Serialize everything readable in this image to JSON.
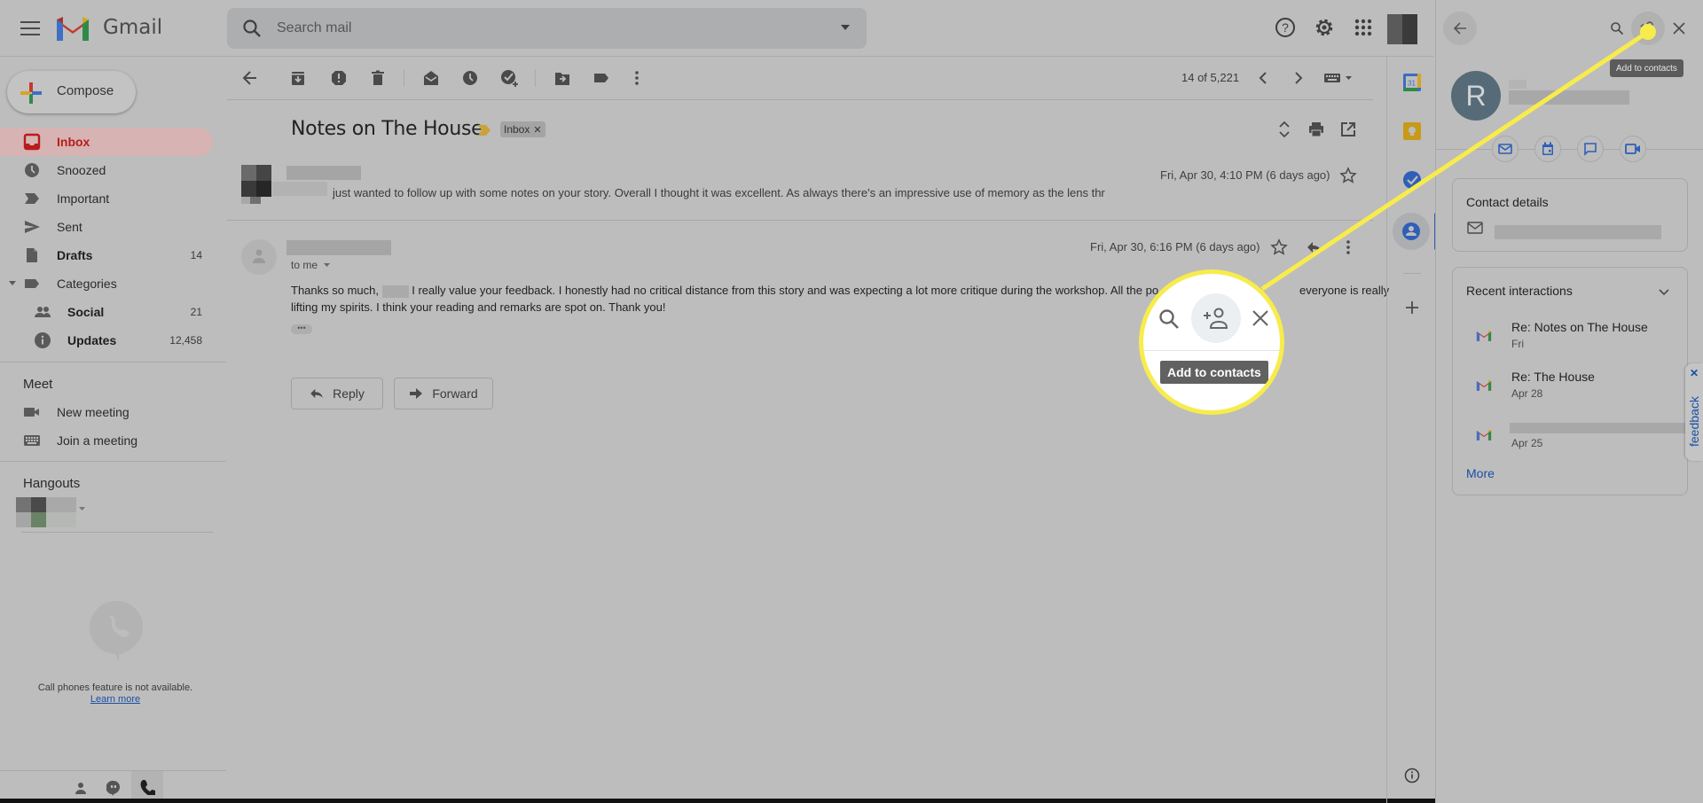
{
  "app": {
    "brand": "Gmail",
    "icons": {
      "menu": "hamburger-icon",
      "logo": "gmail-logo",
      "search": "search-icon",
      "help": "help-icon",
      "settings": "gear-icon",
      "apps": "apps-grid-icon"
    }
  },
  "search": {
    "placeholder": "Search mail",
    "value": ""
  },
  "nav": {
    "compose_label": "Compose",
    "items": [
      {
        "id": "inbox",
        "label": "Inbox",
        "count": "",
        "icon": "inbox-icon",
        "active": true
      },
      {
        "id": "snoozed",
        "label": "Snoozed",
        "count": "",
        "icon": "clock-icon"
      },
      {
        "id": "important",
        "label": "Important",
        "count": "",
        "icon": "important-icon"
      },
      {
        "id": "sent",
        "label": "Sent",
        "count": "",
        "icon": "send-icon"
      },
      {
        "id": "drafts",
        "label": "Drafts",
        "count": "14",
        "icon": "draft-icon",
        "bold": true
      },
      {
        "id": "categories",
        "label": "Categories",
        "count": "",
        "icon": "label-icon"
      },
      {
        "id": "social",
        "label": "Social",
        "count": "21",
        "icon": "people-icon",
        "bold": true
      },
      {
        "id": "updates",
        "label": "Updates",
        "count": "12,458",
        "icon": "info-icon",
        "bold": true
      }
    ],
    "meet": {
      "title": "Meet",
      "items": [
        {
          "label": "New meeting",
          "icon": "videocam-icon"
        },
        {
          "label": "Join a meeting",
          "icon": "keyboard-icon"
        }
      ]
    },
    "hangouts": {
      "title": "Hangouts",
      "call_unavailable": "Call phones feature is not available.",
      "learn_more": "Learn more"
    }
  },
  "toolbar": {
    "pager": "14 of 5,221",
    "icons": [
      "back-icon",
      "archive-icon",
      "report-spam-icon",
      "delete-icon",
      "mark-unread-icon",
      "snooze-icon",
      "add-task-icon",
      "move-to-icon",
      "label-icon",
      "more-icon"
    ]
  },
  "thread": {
    "subject": "Notes on The House",
    "label_chip": "Inbox",
    "messages": [
      {
        "collapsed": true,
        "snippet": "just wanted to follow up with some notes on your story. Overall I thought it was excellent. As always there's an impressive use of memory as the lens thr",
        "date": "Fri, Apr 30, 4:10 PM (6 days ago)"
      },
      {
        "collapsed": false,
        "to": "to me",
        "date": "Fri, Apr 30, 6:16 PM (6 days ago)",
        "body_line1_a": "Thanks so much,",
        "body_line1_b": "I really value your feedback. I honestly had no critical distance from this story and was expecting a lot more critique during the workshop. All the po",
        "body_line1_c": "everyone is really",
        "body_line2": "lifting my spirits. I think your reading and remarks are spot on. Thank you!"
      }
    ],
    "reply_label": "Reply",
    "forward_label": "Forward"
  },
  "callout": {
    "tooltip": "Add to contacts"
  },
  "contact_panel": {
    "avatar_letter": "R",
    "tooltip": "Add to contacts",
    "contact_details_title": "Contact details",
    "recent_title": "Recent interactions",
    "interactions": [
      {
        "title": "Re: Notes on The House",
        "date": "Fri"
      },
      {
        "title": "Re: The House",
        "date": "Apr 28"
      },
      {
        "title": "",
        "date": "Apr 25"
      }
    ],
    "more_label": "More",
    "feedback_label": "feedback"
  },
  "colors": {
    "accent_red": "#b71c1c",
    "link_blue": "#1a4fa6",
    "highlight_yellow": "#f7ec4c",
    "avatar_bg": "#566b77"
  }
}
